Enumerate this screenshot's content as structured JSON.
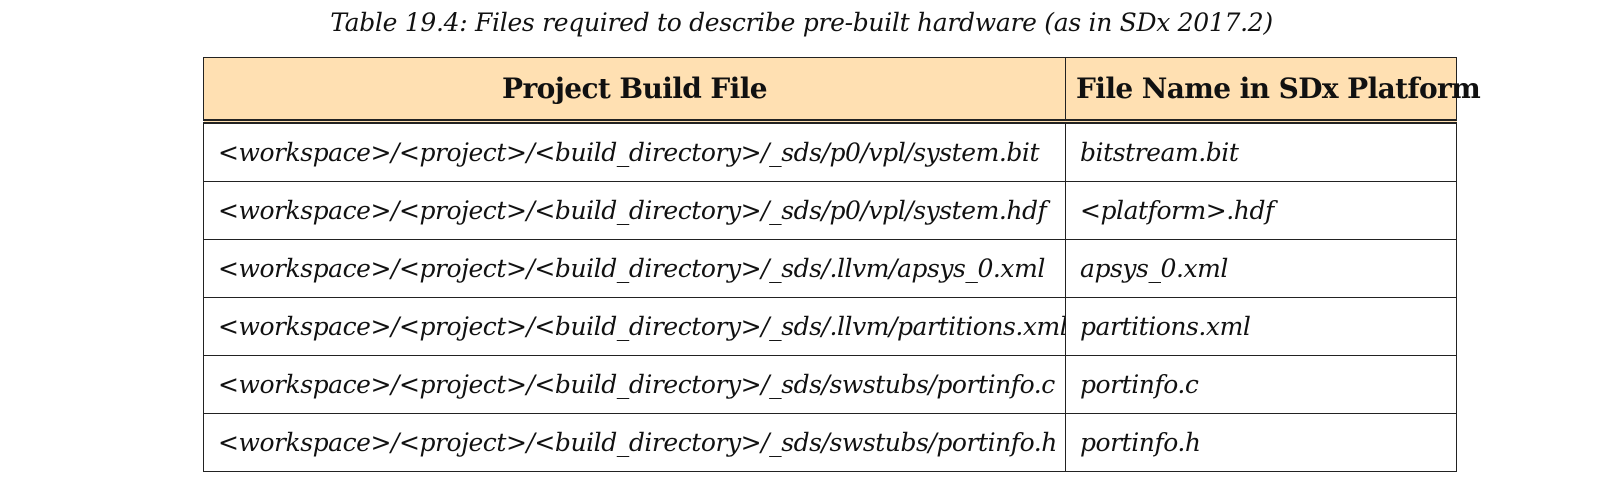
{
  "caption": "Table 19.4: Files required to describe pre-built hardware  (as in SDx 2017.2)",
  "table": {
    "headers": [
      "Project Build File",
      "File Name in SDx Platform"
    ],
    "rows": [
      [
        "<workspace>/<project>/<build_directory>/_sds/p0/vpl/system.bit",
        "bitstream.bit"
      ],
      [
        "<workspace>/<project>/<build_directory>/_sds/p0/vpl/system.hdf",
        "<platform>.hdf"
      ],
      [
        "<workspace>/<project>/<build_directory>/_sds/.llvm/apsys_0.xml",
        "apsys_0.xml"
      ],
      [
        "<workspace>/<project>/<build_directory>/_sds/.llvm/partitions.xml",
        "partitions.xml"
      ],
      [
        "<workspace>/<project>/<build_directory>/_sds/swstubs/portinfo.c",
        "portinfo.c"
      ],
      [
        "<workspace>/<project>/<build_directory>/_sds/swstubs/portinfo.h",
        "portinfo.h"
      ]
    ]
  },
  "colors": {
    "header_background": "#ffe0b2",
    "border": "#222222",
    "text": "#111111"
  }
}
